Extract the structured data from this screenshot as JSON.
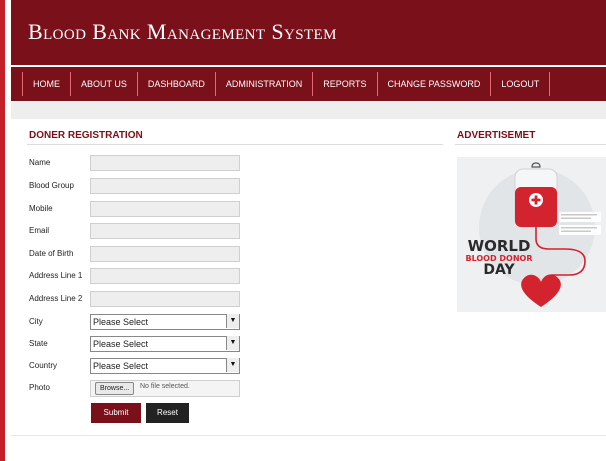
{
  "header": {
    "title": "Blood Bank Management System"
  },
  "nav": {
    "items": [
      "HOME",
      "ABOUT US",
      "DASHBOARD",
      "ADMINISTRATION",
      "REPORTS",
      "CHANGE PASSWORD",
      "LOGOUT"
    ]
  },
  "form": {
    "title": "DONER REGISTRATION",
    "name_label": "Name",
    "blood_group_label": "Blood Group",
    "mobile_label": "Mobile",
    "email_label": "Email",
    "dob_label": "Date of Birth",
    "address1_label": "Address Line 1",
    "address2_label": "Address Line 2",
    "city_label": "City",
    "city_value": "Please Select",
    "state_label": "State",
    "state_value": "Please Select",
    "country_label": "Country",
    "country_value": "Please Select",
    "photo_label": "Photo",
    "browse_label": "Browse...",
    "file_status": "No file selected.",
    "submit_label": "Submit",
    "reset_label": "Reset"
  },
  "sidebar": {
    "title": "ADVERTISEMET",
    "ad": {
      "line1": "WORLD",
      "line2": "BLOOD DONOR",
      "line3": "DAY"
    }
  },
  "colors": {
    "brand": "#7a1019",
    "accent": "#c4202a",
    "nav_divider": "#e06b72"
  }
}
